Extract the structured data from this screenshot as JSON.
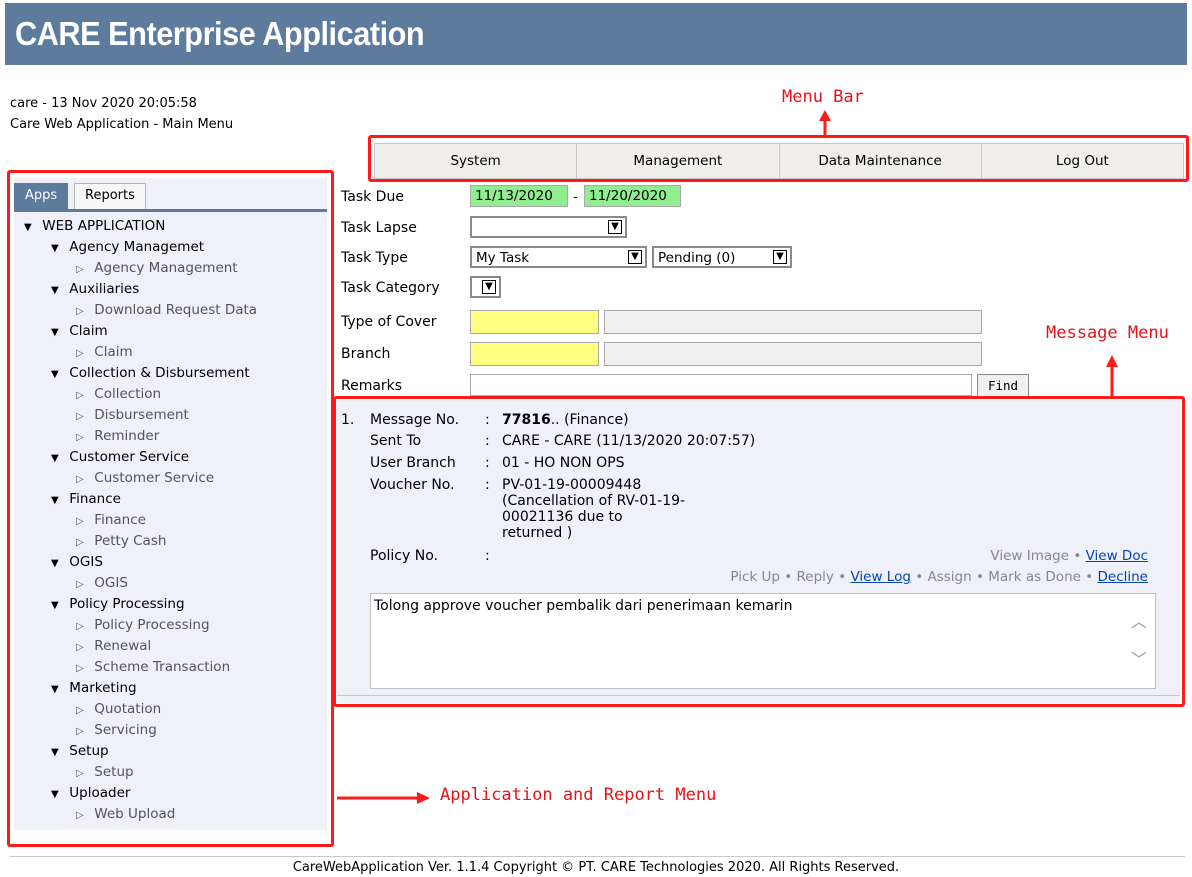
{
  "header": {
    "title": "CARE Enterprise Application",
    "session_line": "care - 13 Nov 2020 20:05:58",
    "subtitle": "Care Web Application - Main Menu"
  },
  "menu": [
    "System",
    "Management",
    "Data Maintenance",
    "Log Out"
  ],
  "sidebar": {
    "tabs": [
      "Apps",
      "Reports"
    ],
    "root": "WEB APPLICATION",
    "groups": [
      {
        "label": "Agency Managemet",
        "items": [
          "Agency Management"
        ]
      },
      {
        "label": "Auxiliaries",
        "items": [
          "Download Request Data"
        ]
      },
      {
        "label": "Claim",
        "items": [
          "Claim"
        ]
      },
      {
        "label": "Collection & Disbursement",
        "items": [
          "Collection",
          "Disbursement",
          "Reminder"
        ]
      },
      {
        "label": "Customer Service",
        "items": [
          "Customer Service"
        ]
      },
      {
        "label": "Finance",
        "items": [
          "Finance",
          "Petty Cash"
        ]
      },
      {
        "label": "OGIS",
        "items": [
          "OGIS"
        ]
      },
      {
        "label": "Policy Processing",
        "items": [
          "Policy Processing",
          "Renewal",
          "Scheme Transaction"
        ]
      },
      {
        "label": "Marketing",
        "items": [
          "Quotation",
          "Servicing"
        ]
      },
      {
        "label": "Setup",
        "items": [
          "Setup"
        ]
      },
      {
        "label": "Uploader",
        "items": [
          "Web Upload"
        ]
      }
    ]
  },
  "form": {
    "task_due_label": "Task Due",
    "task_due_from": "11/13/2020",
    "dash": "-",
    "task_due_to": "11/20/2020",
    "task_lapse_label": "Task Lapse",
    "task_lapse_value": "",
    "task_type_label": "Task Type",
    "task_type_value": "My Task",
    "task_status_value": "Pending (0)",
    "task_category_label": "Task Category",
    "task_category_value": "",
    "type_of_cover_label": "Type of Cover",
    "branch_label": "Branch",
    "remarks_label": "Remarks",
    "remarks_value": "",
    "find_label": "Find"
  },
  "message": {
    "index": "1.",
    "fields": [
      {
        "label": "Message No.",
        "sep": ":",
        "value_bold": "77816",
        "value": ".. (Finance)"
      },
      {
        "label": "Sent To",
        "sep": ":",
        "value": "CARE - CARE (11/13/2020 20:07:57)"
      },
      {
        "label": "User Branch",
        "sep": ":",
        "value": "01 - HO NON OPS"
      },
      {
        "label": "Voucher No.",
        "sep": ":",
        "value": "PV-01-19-00009448"
      },
      {
        "label": "Policy No.",
        "sep": ":",
        "value": ""
      }
    ],
    "voucher_note": [
      "(Cancellation of RV-01-19-",
      "00021136 due to",
      "returned )"
    ],
    "actions_row1": [
      "View Image",
      "View Doc"
    ],
    "actions_row2": [
      "Pick Up",
      "Reply",
      "View Log",
      "Assign",
      "Mark as Done",
      "Decline"
    ],
    "bullet": "•",
    "body": "Tolong approve voucher pembalik dari penerimaan kemarin"
  },
  "annotations": {
    "menu_bar": "Menu Bar",
    "message_menu": "Message Menu",
    "app_menu": "Application and Report Menu",
    "color": "#ff1a1a"
  },
  "footer": "CareWebApplication Ver. 1.1.4 Copyright © PT. CARE Technologies 2020. All Rights Reserved."
}
